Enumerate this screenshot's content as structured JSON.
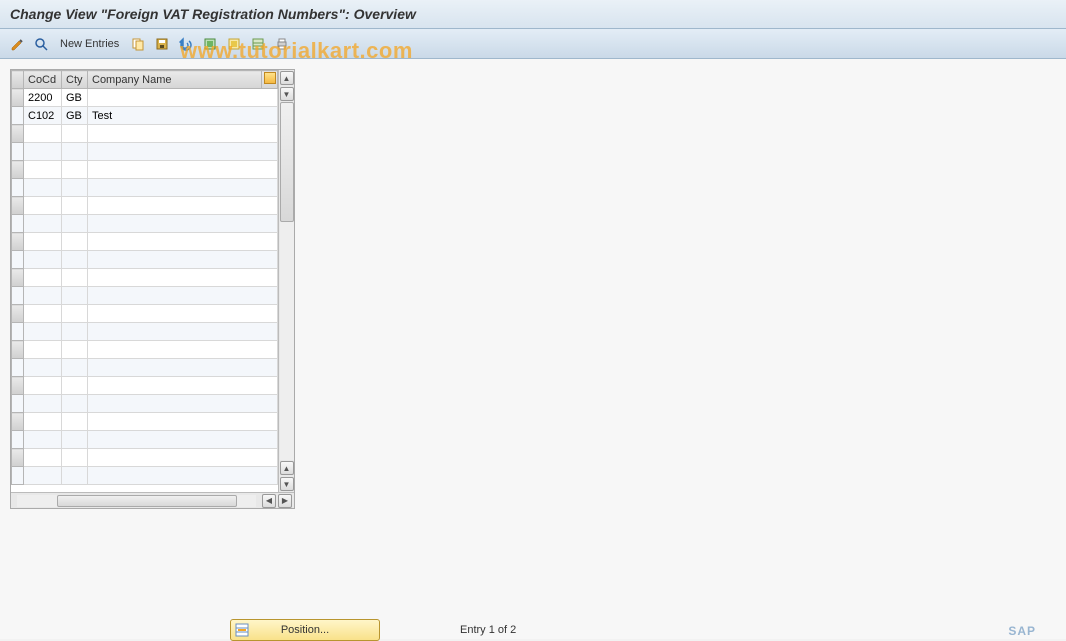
{
  "title": "Change View \"Foreign VAT Registration Numbers\": Overview",
  "toolbar": {
    "new_entries_label": "New Entries"
  },
  "watermark": "www.tutorialkart.com",
  "table": {
    "columns": {
      "cocd": "CoCd",
      "cty": "Cty",
      "company_name": "Company Name"
    },
    "rows": [
      {
        "cocd": "2200",
        "cty": "GB",
        "company_name": ""
      },
      {
        "cocd": "C102",
        "cty": "GB",
        "company_name": "Test"
      }
    ]
  },
  "footer": {
    "position_label": "Position...",
    "entry_label": "Entry 1 of 2"
  },
  "logo": "SAP"
}
